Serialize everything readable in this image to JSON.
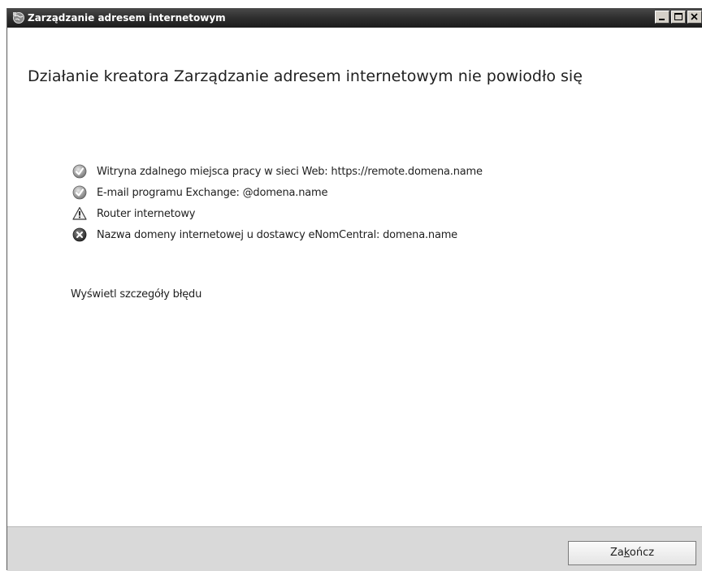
{
  "window": {
    "title": "Zarządzanie adresem internetowym"
  },
  "main": {
    "heading": "Działanie kreatora Zarządzanie adresem internetowym nie powiodło się",
    "items": [
      {
        "status": "success",
        "icon": "check-icon",
        "label": "Witryna zdalnego miejsca pracy w sieci Web: https://remote.domena.name"
      },
      {
        "status": "success",
        "icon": "check-icon",
        "label": "E-mail programu Exchange: @domena.name"
      },
      {
        "status": "warning",
        "icon": "warning-icon",
        "label": "Router internetowy"
      },
      {
        "status": "error",
        "icon": "error-icon",
        "label": "Nazwa domeny internetowej u dostawcy eNomCentral: domena.name"
      }
    ],
    "details_link": "Wyświetl szczegóły błędu"
  },
  "footer": {
    "finish_pre": "Za",
    "finish_accel": "k",
    "finish_post": "ończ"
  }
}
